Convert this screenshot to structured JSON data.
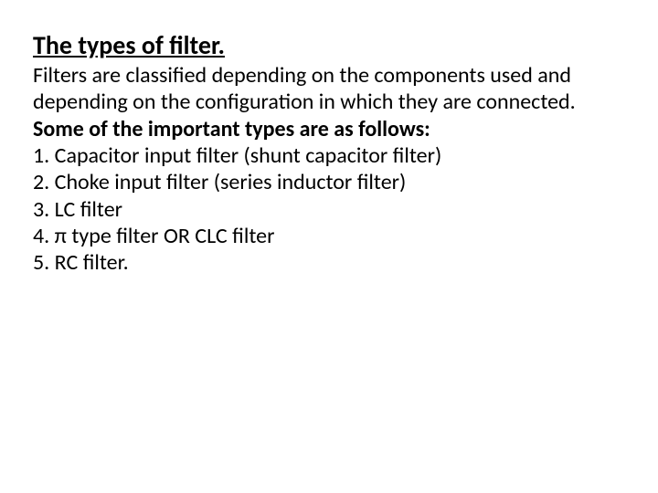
{
  "title": "The types of filter.",
  "intro": "Filters are classified depending on the components used and depending on the configuration in which they are connected.",
  "subhead": "Some of the important types are as follows:",
  "items": {
    "0": "1. Capacitor input filter (shunt capacitor filter)",
    "1": "2. Choke input filter (series inductor filter)",
    "2": "3. LC filter",
    "3": "4. π type filter OR CLC filter",
    "4": "5. RC filter."
  }
}
